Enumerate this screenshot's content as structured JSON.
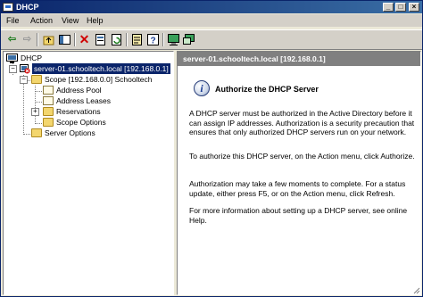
{
  "window": {
    "title": "DHCP"
  },
  "menu": {
    "file": "File",
    "action": "Action",
    "view": "View",
    "help": "Help"
  },
  "toolbar": {
    "icons": [
      "back-arrow-icon",
      "forward-arrow-icon",
      "up-level-icon",
      "show-hide-tree-icon",
      "delete-icon",
      "properties-icon",
      "refresh-icon",
      "export-list-icon",
      "help-icon",
      "server-icon",
      "authorize-icon"
    ]
  },
  "tree": {
    "root": "DHCP",
    "server": "server-01.schooltech.local [192.168.0.1]",
    "scope": "Scope [192.168.0.0] Schooltech",
    "address_pool": "Address Pool",
    "address_leases": "Address Leases",
    "reservations": "Reservations",
    "scope_options": "Scope Options",
    "server_options": "Server Options"
  },
  "details": {
    "header": "server-01.schooltech.local [192.168.0.1]",
    "title": "Authorize the DHCP Server",
    "p1": "A DHCP server must be authorized in the Active Directory before it can assign IP addresses. Authorization is a security precaution that ensures that only authorized DHCP servers run on your network.",
    "p2": "To authorize this DHCP server, on the Action menu, click Authorize.",
    "p3": "Authorization may take a few moments to complete. For a status update, either press F5, or on the Action menu, click Refresh.",
    "p4": "For more information about setting up a DHCP server, see online Help."
  },
  "colors": {
    "titlebar_start": "#0a246a",
    "titlebar_end": "#3a6ea5",
    "selection": "#0a246a",
    "header_bg": "#808080"
  }
}
